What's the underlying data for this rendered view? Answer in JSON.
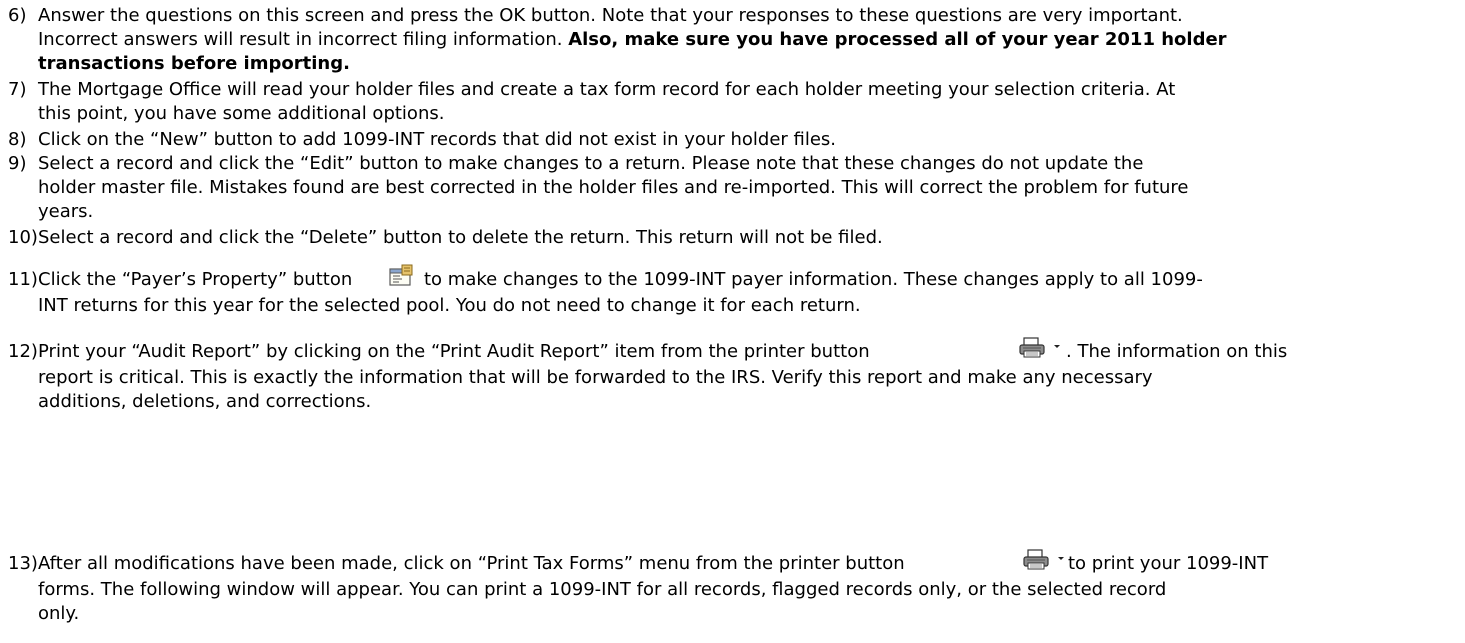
{
  "items": [
    {
      "number": "6)",
      "lines": [
        "Answer the questions on this screen and press the OK button. Note that your responses to these questions are very important.",
        "Incorrect answers will result in incorrect filing information. ",
        "transactions before importing."
      ],
      "bold_tail": "Also, make sure you have processed all of your year 2011 holder"
    },
    {
      "number": "7)",
      "lines": [
        "The Mortgage Office will read your holder files and create a tax form record for each holder  meeting your selection criteria. At",
        "this point, you have some additional options."
      ]
    },
    {
      "number": "8)",
      "lines": [
        "Click on the “New” button to add 1099-INT records that did not exist in your holder files."
      ]
    },
    {
      "number": "9)",
      "lines": [
        "Select a record and click the “Edit” button to make changes to a return. Please note that these changes do not update the",
        "holder master file. Mistakes found are best corrected in the holder files and re-imported. This will correct the problem for future",
        "years."
      ]
    },
    {
      "number": "10)",
      "lines": [
        "Select a record and click the “Delete” button to delete the return. This return will not be filed."
      ]
    },
    {
      "number": "11)",
      "lines": [
        "Click the “Payer’s Property” button",
        "to make changes to the 1099-INT payer information. These changes apply to all 1099-",
        "INT returns for this year for the selected pool. You do not need to change it for each return."
      ]
    },
    {
      "number": "12)",
      "lines": [
        "Print your “Audit Report” by clicking on the “Print Audit Report” item from the printer button",
        ". The information on this",
        "report is critical. This is exactly the information that will be forwarded to the IRS. Verify this report and make any necessary",
        "additions, deletions, and corrections."
      ]
    },
    {
      "number": "13)",
      "lines": [
        "After all modifications have been made, click on “Print Tax Forms” menu from the printer button",
        "to print your 1099-INT",
        "forms. The following window will appear. You can print a 1099-INT for all records, flagged records only, or the selected record",
        "only."
      ]
    }
  ],
  "icons": {
    "payer_property": "payer-property-icon",
    "printer": "printer-dropdown-icon"
  }
}
